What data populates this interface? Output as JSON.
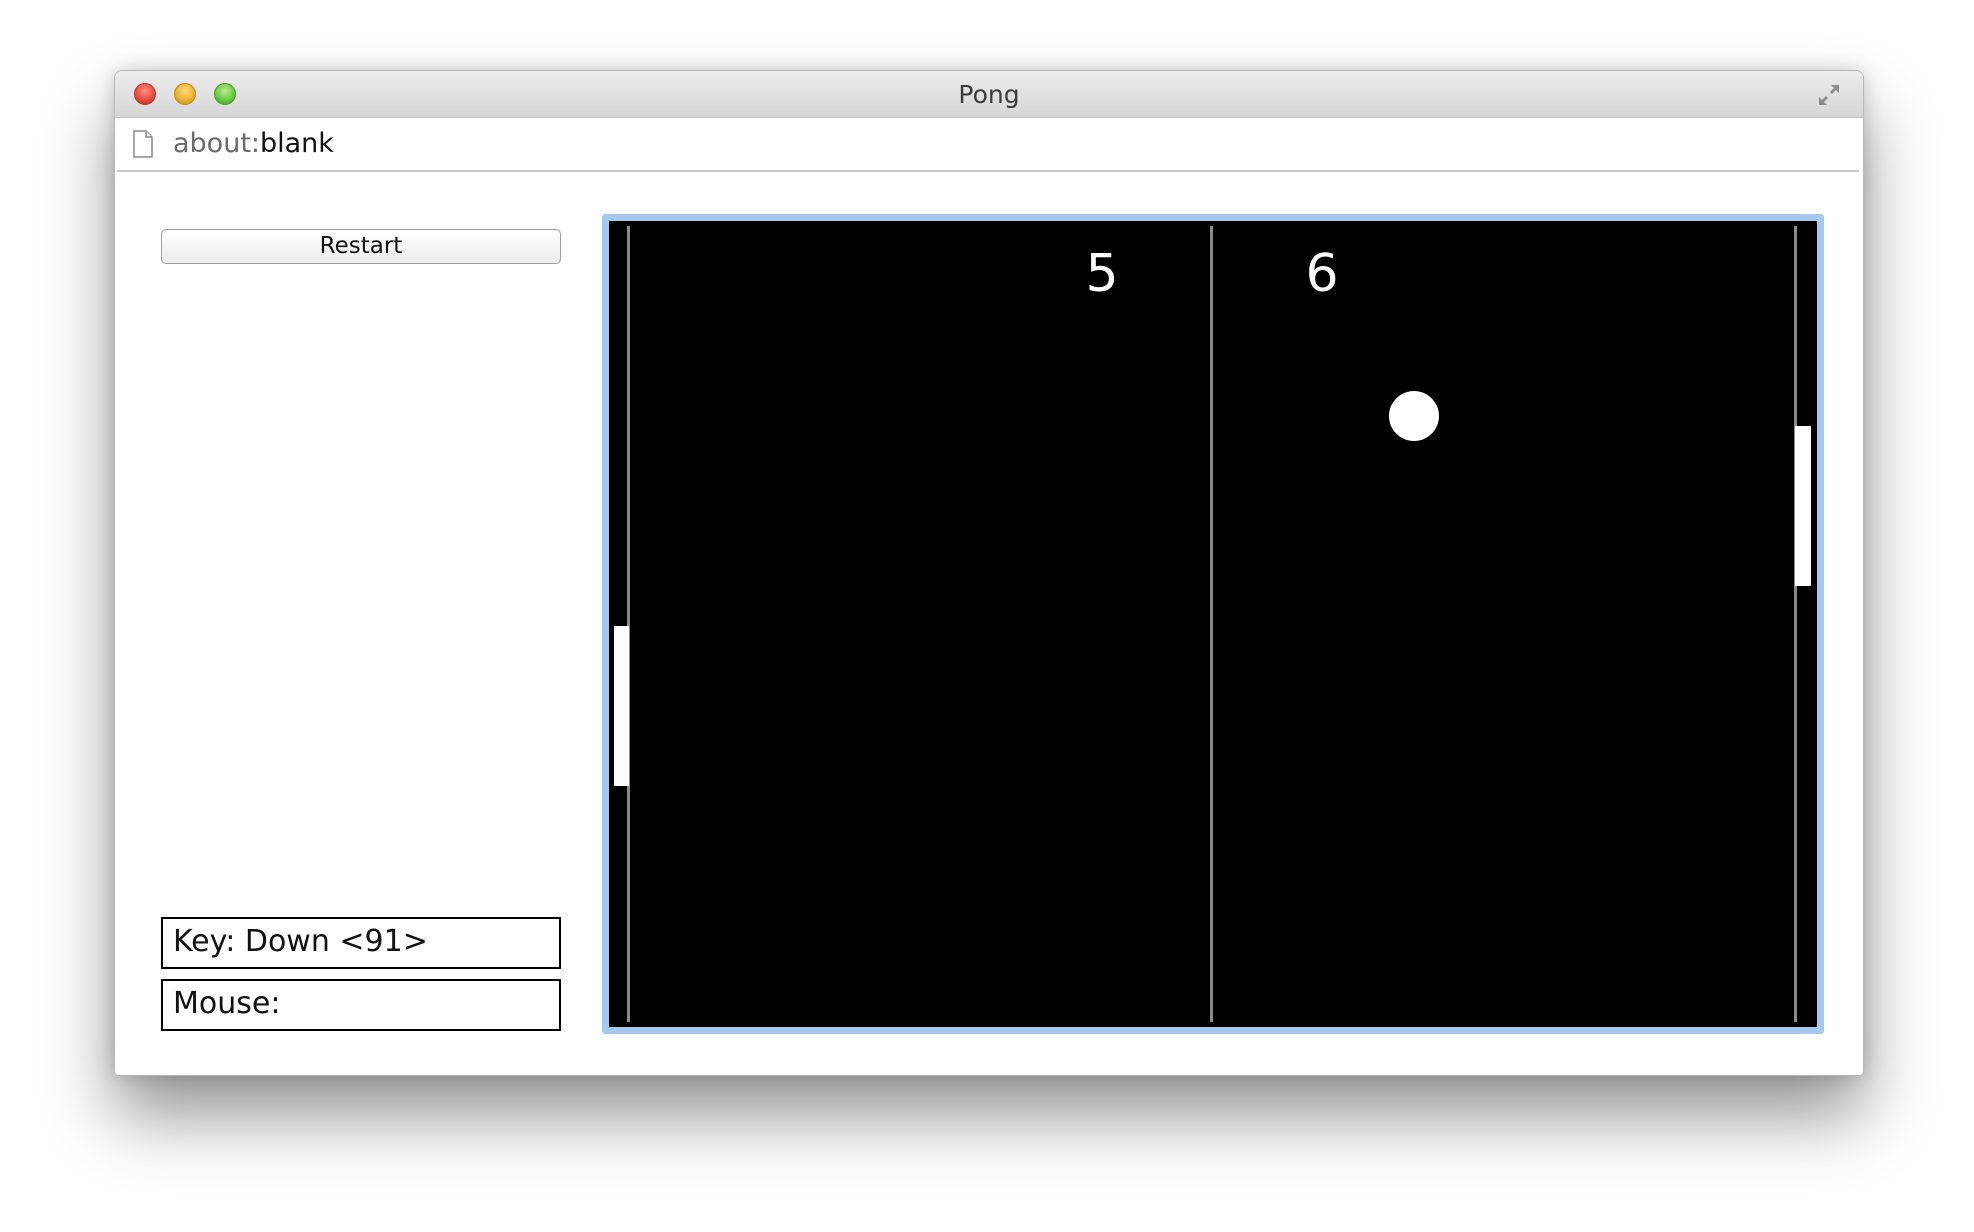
{
  "window": {
    "title": "Pong"
  },
  "address_bar": {
    "scheme": "about:",
    "path": "blank",
    "icon": "page-icon"
  },
  "controls": {
    "restart_label": "Restart"
  },
  "status": {
    "key_text": "Key: Down <91>",
    "mouse_text": "Mouse:"
  },
  "game": {
    "score_left": "5",
    "score_right": "6",
    "colors": {
      "background": "#000000",
      "foreground": "#ffffff",
      "lines": "#8a8a8a",
      "focus_border": "#a7c8ee"
    }
  }
}
